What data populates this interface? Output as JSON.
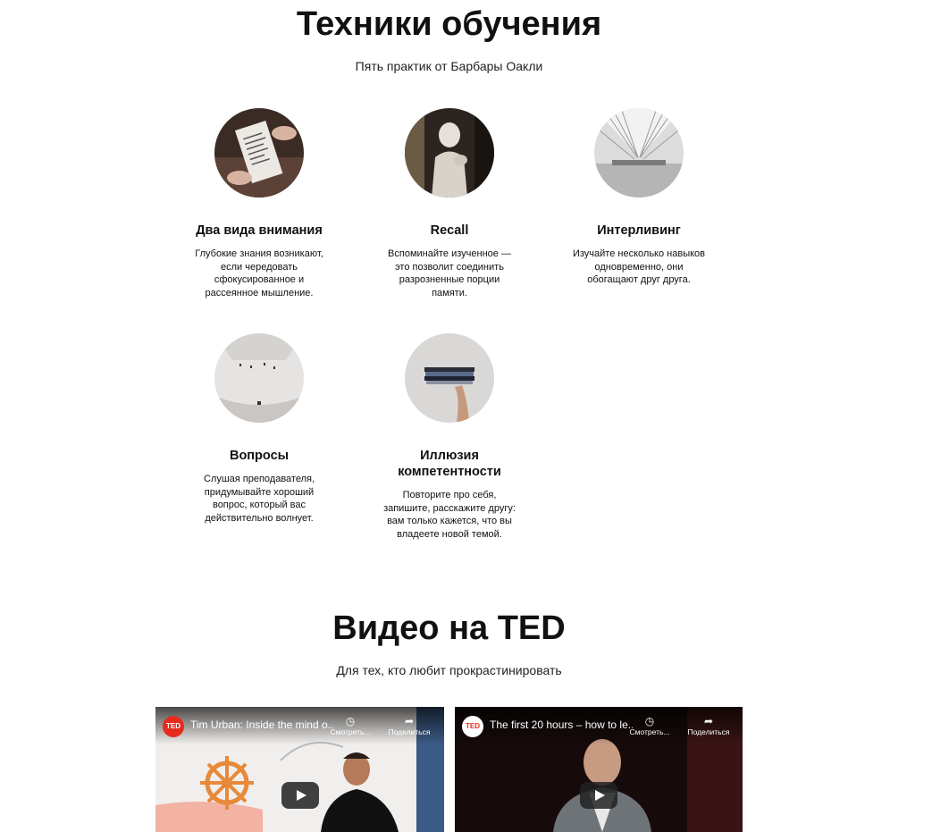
{
  "techniques": {
    "title": "Техники обучения",
    "subtitle": "Пять практик от Барбары Оакли",
    "items": [
      {
        "title": "Два вида внимания",
        "text": "Глубокие знания возникают, если чередовать сфокусированное и рассеянное мышление.",
        "image": "book-photo"
      },
      {
        "title": "Recall",
        "text": "Вспоминайте изученное — это позволит соединить разрозненные порции памяти.",
        "image": "statue-photo"
      },
      {
        "title": "Интерливинг",
        "text": "Изучайте несколько навыков одновременно, они обогащают друг друга.",
        "image": "hall-photo"
      },
      {
        "title": "Вопросы",
        "text": "Слушая преподавателя, придумывайте хороший вопрос, который вас действительно волнует.",
        "image": "room-photo"
      },
      {
        "title": "Иллюзия компетентности",
        "text": "Повторите про себя, запишите, расскажите другу: вам только кажется, что вы владеете новой темой.",
        "image": "books-photo"
      }
    ]
  },
  "videos": {
    "title": "Видео на TED",
    "subtitle": "Для тех, кто любит прокрастинировать",
    "items": [
      {
        "logo": "TED",
        "title": "Tim Urban: Inside the mind o...",
        "watch_later": "Смотреть...",
        "share": "Поделиться"
      },
      {
        "logo": "TED",
        "title": "The first 20 hours – how to le...",
        "watch_later": "Смотреть...",
        "share": "Поделиться"
      }
    ]
  },
  "colors": {
    "ted_red": "#e62b1e"
  }
}
